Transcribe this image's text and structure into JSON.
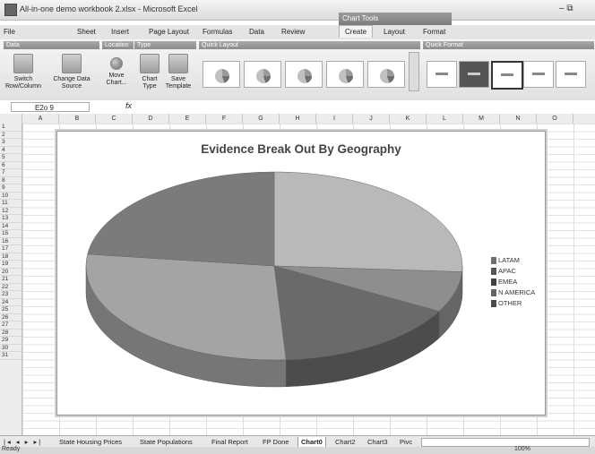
{
  "window": {
    "title": "All-in-one demo workbook 2.xlsx - Microsoft Excel",
    "context_tab_group": "Chart Tools",
    "controls": "–  ⧉"
  },
  "tabs": [
    "File",
    "Sheet",
    "Insert",
    "Page Layout",
    "Formulas",
    "Data",
    "Review",
    "Create",
    "Layout",
    "Format"
  ],
  "active_tab": "Create",
  "ribbon": {
    "groups": [
      "Data",
      "Location",
      "Type",
      "Quick Layout",
      "Quick Format"
    ],
    "buttons": {
      "switch": "Switch Row/Column",
      "change": "Change Data Source",
      "move": "Move Chart...",
      "chart_type": "Chart Type",
      "save_template": "Save Template"
    }
  },
  "formula_bar": {
    "name_box": "E2o 9",
    "fx": "fx",
    "value": ""
  },
  "columns": [
    "A",
    "B",
    "C",
    "D",
    "E",
    "F",
    "G",
    "H",
    "I",
    "J",
    "K",
    "L",
    "M",
    "N",
    "O"
  ],
  "rows": [
    "1",
    "2",
    "3",
    "4",
    "5",
    "6",
    "7",
    "8",
    "9",
    "10",
    "11",
    "12",
    "13",
    "14",
    "15",
    "16",
    "17",
    "18",
    "19",
    "20",
    "21",
    "22",
    "23",
    "24",
    "25",
    "26",
    "27",
    "28",
    "29",
    "30",
    "31"
  ],
  "chart_data": {
    "type": "pie",
    "title": "Evidence Break Out By Geography",
    "categories": [
      "LATAM",
      "APAC",
      "EMEA",
      "N AMERICA",
      "OTHER"
    ],
    "values": [
      26,
      7,
      16,
      28,
      23
    ],
    "legend_position": "right",
    "colors": [
      "#b9b9b9",
      "#8e8e8e",
      "#6a6a6a",
      "#a4a4a4",
      "#7b7b7b"
    ]
  },
  "sheet_tabs": [
    "State Housing Prices",
    "State Populations",
    "Final Report",
    "FP Done",
    "Chart0",
    "Chart2",
    "Chart3",
    "Pivc"
  ],
  "active_sheet": "Chart0",
  "status": {
    "left": "Ready",
    "zoom": "100%"
  }
}
